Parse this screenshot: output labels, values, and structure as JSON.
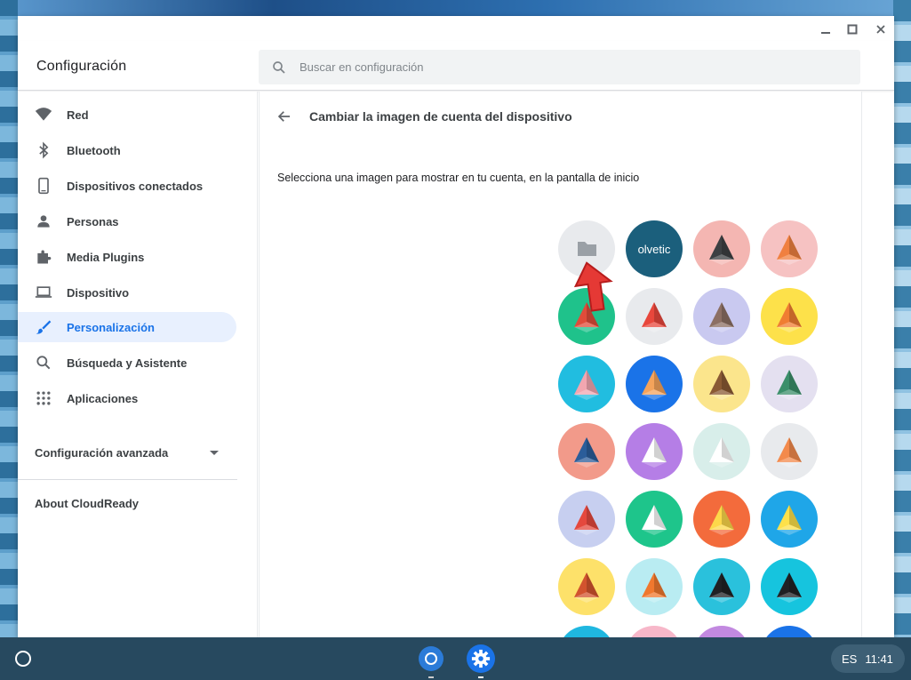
{
  "window": {
    "title": "Configuración",
    "controls": [
      "minimize",
      "maximize",
      "close"
    ]
  },
  "search": {
    "placeholder": "Buscar en configuración",
    "value": ""
  },
  "sidebar": {
    "items": [
      {
        "label": "Red",
        "icon": "wifi-icon"
      },
      {
        "label": "Bluetooth",
        "icon": "bluetooth-icon"
      },
      {
        "label": "Dispositivos conectados",
        "icon": "phone-icon"
      },
      {
        "label": "Personas",
        "icon": "person-icon"
      },
      {
        "label": "Media Plugins",
        "icon": "puzzle-icon"
      },
      {
        "label": "Dispositivo",
        "icon": "laptop-icon"
      },
      {
        "label": "Personalización",
        "icon": "brush-icon",
        "active": true
      },
      {
        "label": "Búsqueda y Asistente",
        "icon": "search-icon"
      },
      {
        "label": "Aplicaciones",
        "icon": "apps-grid-icon"
      }
    ],
    "advanced_label": "Configuración avanzada",
    "about_label": "About CloudReady"
  },
  "page": {
    "title": "Cambiar la imagen de cuenta del dispositivo",
    "description": "Selecciona una imagen para mostrar en tu cuenta, en la pantalla de inicio",
    "avatars": [
      {
        "name": "choose-file",
        "bg": "#e8eaed",
        "fg": "#9aa0a6",
        "kind": "folder"
      },
      {
        "name": "olvetic",
        "bg": "#1b5f7c",
        "fg": "#ffffff",
        "kind": "text",
        "text": "olvetic"
      },
      {
        "name": "penguin",
        "bg": "#f4b6b2",
        "fg": "#3c4043",
        "kind": "origami"
      },
      {
        "name": "fox",
        "bg": "#f6c2c2",
        "fg": "#f08040",
        "kind": "origami"
      },
      {
        "name": "bull",
        "bg": "#1fc28b",
        "fg": "#e04c3a",
        "kind": "origami"
      },
      {
        "name": "butterfly-red",
        "bg": "#e8eaed",
        "fg": "#e8473c",
        "kind": "origami"
      },
      {
        "name": "cat",
        "bg": "#c9c9f0",
        "fg": "#8c6f63",
        "kind": "origami"
      },
      {
        "name": "corgi",
        "bg": "#fde14a",
        "fg": "#f07d32",
        "kind": "origami"
      },
      {
        "name": "rabbit",
        "bg": "#21bde0",
        "fg": "#f2a6b0",
        "kind": "origami"
      },
      {
        "name": "butterfly-orange",
        "bg": "#1a73e8",
        "fg": "#f4a35b",
        "kind": "origami"
      },
      {
        "name": "monkey",
        "bg": "#fbe58c",
        "fg": "#8a5a34",
        "kind": "origami"
      },
      {
        "name": "dragon",
        "bg": "#e4e0f0",
        "fg": "#3b8f6a",
        "kind": "origami"
      },
      {
        "name": "elephant",
        "bg": "#f29a8a",
        "fg": "#2b5d9a",
        "kind": "origami"
      },
      {
        "name": "panda",
        "bg": "#b57ee6",
        "fg": "#ffffff",
        "kind": "origami"
      },
      {
        "name": "unicorn",
        "bg": "#d8eeea",
        "fg": "#ffffff",
        "kind": "origami"
      },
      {
        "name": "birds",
        "bg": "#e8eaed",
        "fg": "#f38a4c",
        "kind": "origami"
      },
      {
        "name": "cardinal",
        "bg": "#c7cff0",
        "fg": "#e5483d",
        "kind": "origami"
      },
      {
        "name": "ramen",
        "bg": "#1ec58b",
        "fg": "#ffffff",
        "kind": "origami"
      },
      {
        "name": "tamagotchi",
        "bg": "#f36b3c",
        "fg": "#fdd84a",
        "kind": "origami"
      },
      {
        "name": "cheese",
        "bg": "#1fa6e8",
        "fg": "#fde14a",
        "kind": "origami"
      },
      {
        "name": "football",
        "bg": "#fde16a",
        "fg": "#d2532e",
        "kind": "origami"
      },
      {
        "name": "basketball",
        "bg": "#b9ecf2",
        "fg": "#f0782e",
        "kind": "origami"
      },
      {
        "name": "vinyl",
        "bg": "#2ac1dc",
        "fg": "#202124",
        "kind": "origami"
      },
      {
        "name": "sushi",
        "bg": "#16c4de",
        "fg": "#202124",
        "kind": "origami"
      },
      {
        "name": "bicycle",
        "bg": "#1fb7e0",
        "fg": "#f25f5c",
        "kind": "origami"
      },
      {
        "name": "sunglasses",
        "bg": "#f7b7c9",
        "fg": "#202124",
        "kind": "origami"
      },
      {
        "name": "cake",
        "bg": "#c289e0",
        "fg": "#fde14a",
        "kind": "origami"
      },
      {
        "name": "burger",
        "bg": "#1a73e8",
        "fg": "#7cc96b",
        "kind": "origami"
      }
    ]
  },
  "taskbar": {
    "language": "ES",
    "time": "11:41",
    "apps": [
      {
        "name": "chrome",
        "color": "#2b7bd8"
      },
      {
        "name": "settings",
        "color": "#1a73e8"
      }
    ]
  }
}
